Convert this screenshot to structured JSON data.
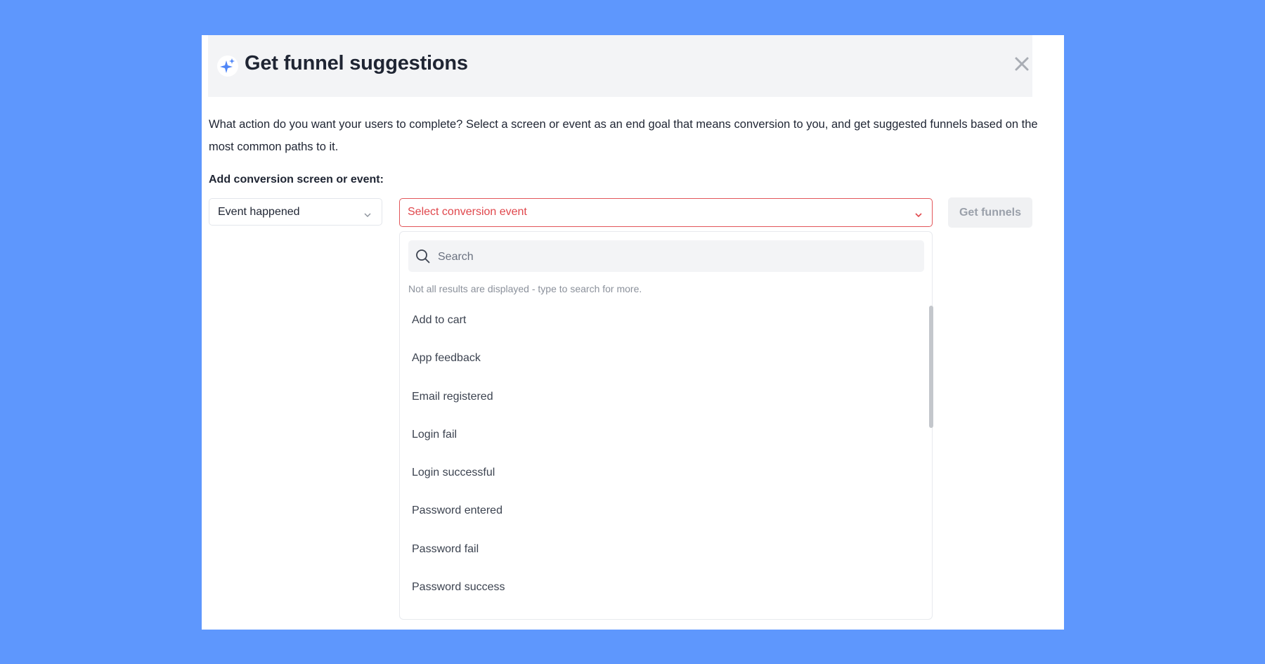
{
  "modal": {
    "title": "Get funnel suggestions",
    "description": "What action do you want your users to complete? Select a screen or event as an end goal that means conversion to you, and get suggested funnels based on the most common paths to it.",
    "add_label": "Add conversion screen or event:"
  },
  "type_select": {
    "value": "Event happened"
  },
  "event_select": {
    "placeholder": "Select conversion event"
  },
  "get_button": {
    "label": "Get funnels"
  },
  "dropdown": {
    "search_placeholder": "Search",
    "hint": "Not all results are displayed - type to search for more.",
    "items": [
      "Add to cart",
      "App feedback",
      "Email registered",
      "Login fail",
      "Login successful",
      "Password entered",
      "Password fail",
      "Password success"
    ]
  },
  "icons": {
    "header": "sparkle-icon",
    "close": "close-icon",
    "chevron": "chevron-down-icon",
    "search": "search-icon"
  },
  "colors": {
    "background": "#5e97fd",
    "accent": "#4f86f7",
    "error": "#e0474c"
  }
}
